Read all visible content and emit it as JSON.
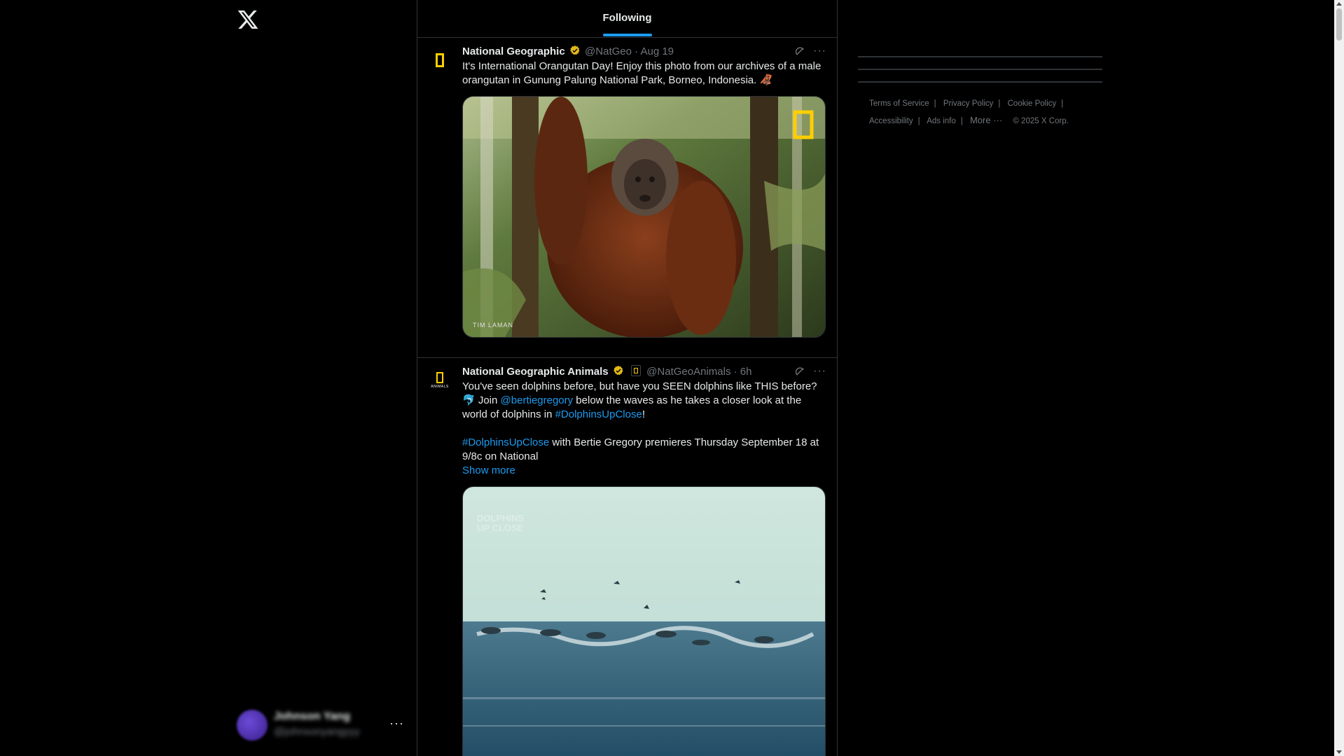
{
  "nav": {
    "logo": "x-logo-icon",
    "account": {
      "name": "Johnson Yang",
      "handle": "@johnsonyangyyy",
      "more": "···"
    }
  },
  "timeline": {
    "tab": "Following",
    "tweets": [
      {
        "name": "National Geographic",
        "handle": "@NatGeo",
        "time": "Aug 19",
        "text": "It's International Orangutan Day! Enjoy this photo from our archives of a male orangutan in Gunung Palung National Park, Borneo, Indonesia. 🦧",
        "media_credit": "TIM LAMAN"
      },
      {
        "name": "National Geographic Animals",
        "handle": "@NatGeoAnimals",
        "time": "6h",
        "avatar_sub": "ANIMALS",
        "line1_a": "You've seen dolphins before, but have you SEEN dolphins like THIS before? 🐬 Join ",
        "mention": "@bertiegregory",
        "line1_b": " below the waves as he takes a closer look at the world of dolphins in ",
        "hashtag1": "#DolphinsUpClose",
        "line1_c": "!",
        "hashtag2": "#DolphinsUpClose",
        "line2": " with Bertie Gregory premieres Thursday September 18 at 9/8c on National",
        "show_more": "Show more",
        "video_watermark": "DOLPHINS UP CLOSE"
      }
    ]
  },
  "footer": {
    "links": [
      "Terms of Service",
      "Privacy Policy",
      "Cookie Policy",
      "Accessibility",
      "Ads info",
      "More ···"
    ],
    "copyright": "© 2025 X Corp."
  },
  "colors": {
    "accent": "#1d9bf0",
    "natgeo_yellow": "#ffce00",
    "border": "#2f3336",
    "muted": "#71767b"
  }
}
